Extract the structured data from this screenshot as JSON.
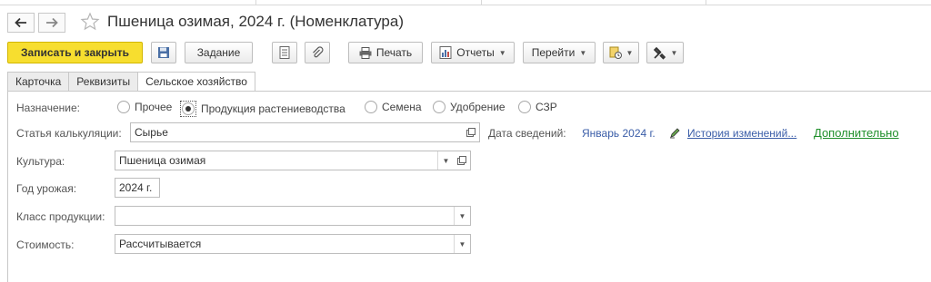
{
  "window": {
    "title": "Пшеница озимая, 2024 г. (Номенклатура)"
  },
  "toolbar": {
    "save_close_label": "Записать и закрыть",
    "task_label": "Задание",
    "print_label": "Печать",
    "reports_label": "Отчеты",
    "goto_label": "Перейти"
  },
  "tabs": [
    {
      "label": "Карточка"
    },
    {
      "label": "Реквизиты"
    },
    {
      "label": "Сельское хозяйство"
    }
  ],
  "form": {
    "purpose": {
      "label": "Назначение:",
      "options": [
        "Прочее",
        "Продукция растениеводства",
        "Семена",
        "Удобрение",
        "СЗР"
      ],
      "selected": "Продукция растениеводства"
    },
    "cost_item": {
      "label": "Статья калькуляции:",
      "value": "Сырье"
    },
    "info_date": {
      "label": "Дата сведений:",
      "value": "Январь 2024 г."
    },
    "history_link": "История изменений...",
    "additional_link": "Дополнительно",
    "culture": {
      "label": "Культура:",
      "value": "Пшеница озимая"
    },
    "harvest_year": {
      "label": "Год урожая:",
      "value": "2024 г."
    },
    "product_class": {
      "label": "Класс продукции:",
      "value": ""
    },
    "cost": {
      "label": "Стоимость:",
      "value": "Рассчитывается"
    }
  },
  "icons": {
    "back": "arrow-left-icon",
    "forward": "arrow-right-icon",
    "favorite": "star-icon",
    "save": "floppy-disk-icon",
    "document": "document-list-icon",
    "attach": "paperclip-icon",
    "print": "printer-icon",
    "reports": "report-icon",
    "create_based": "create-based-on-icon",
    "tools": "tools-icon",
    "open": "open-window-icon",
    "edit_history": "pencil-icon"
  },
  "colors": {
    "primary_button": "#f7de2f",
    "link": "#3a5da8",
    "green_link": "#1f8f2a"
  }
}
